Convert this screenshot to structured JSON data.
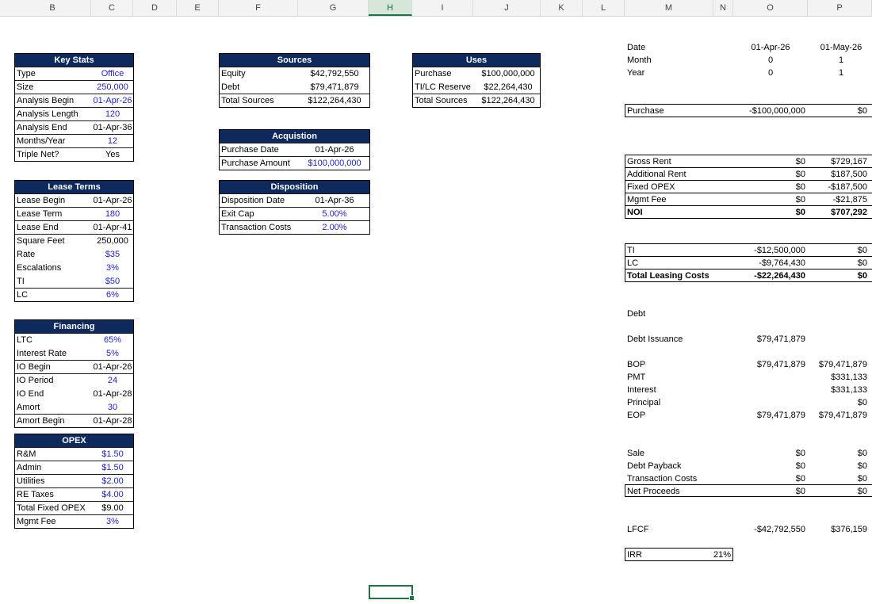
{
  "columns": [
    "B",
    "C",
    "D",
    "E",
    "F",
    "G",
    "H",
    "I",
    "J",
    "K",
    "L",
    "M",
    "N",
    "O",
    "P"
  ],
  "selected_column": "H",
  "key_stats": {
    "title": "Key Stats",
    "rows": [
      {
        "label": "Type",
        "value": "Office",
        "blue": true
      },
      {
        "label": "Size",
        "value": "250,000",
        "blue": true
      },
      {
        "label": "Analysis Begin",
        "value": "01-Apr-26",
        "blue": true
      },
      {
        "label": "Analysis Length",
        "value": "120",
        "blue": true
      },
      {
        "label": "Analysis End",
        "value": "01-Apr-36",
        "blue": false
      },
      {
        "label": "Months/Year",
        "value": "12",
        "blue": true
      },
      {
        "label": "Triple Net?",
        "value": "Yes",
        "blue": false
      }
    ]
  },
  "lease_terms": {
    "title": "Lease Terms",
    "rows": [
      {
        "label": "Lease Begin",
        "value": "01-Apr-26",
        "blue": false
      },
      {
        "label": "Lease Term",
        "value": "180",
        "blue": true
      },
      {
        "label": "Lease End",
        "value": "01-Apr-41",
        "blue": false
      },
      {
        "label": "Square Feet",
        "value": "250,000",
        "blue": false
      },
      {
        "label": "Rate",
        "value": "$35",
        "blue": true
      },
      {
        "label": "Escalations",
        "value": "3%",
        "blue": true
      },
      {
        "label": "TI",
        "value": "$50",
        "blue": true
      },
      {
        "label": "LC",
        "value": "6%",
        "blue": true
      }
    ]
  },
  "financing": {
    "title": "Financing",
    "rows": [
      {
        "label": "LTC",
        "value": "65%",
        "blue": true
      },
      {
        "label": "Interest Rate",
        "value": "5%",
        "blue": true
      },
      {
        "label": "IO Begin",
        "value": "01-Apr-26",
        "blue": false
      },
      {
        "label": "IO Period",
        "value": "24",
        "blue": true
      },
      {
        "label": "IO End",
        "value": "01-Apr-28",
        "blue": false
      },
      {
        "label": "Amort",
        "value": "30",
        "blue": true
      },
      {
        "label": "Amort Begin",
        "value": "01-Apr-28",
        "blue": false
      }
    ]
  },
  "opex": {
    "title": "OPEX",
    "rows": [
      {
        "label": "R&M",
        "value": "$1.50",
        "blue": true
      },
      {
        "label": "Admin",
        "value": "$1.50",
        "blue": true
      },
      {
        "label": "Utilities",
        "value": "$2.00",
        "blue": true
      },
      {
        "label": "RE Taxes",
        "value": "$4.00",
        "blue": true
      },
      {
        "label": "Total Fixed OPEX",
        "value": "$9.00",
        "blue": false
      },
      {
        "label": "Mgmt Fee",
        "value": "3%",
        "blue": true
      }
    ]
  },
  "sources": {
    "title": "Sources",
    "rows": [
      {
        "label": "Equity",
        "value": "$42,792,550"
      },
      {
        "label": "Debt",
        "value": "$79,471,879"
      },
      {
        "label": "Total Sources",
        "value": "$122,264,430"
      }
    ]
  },
  "uses": {
    "title": "Uses",
    "rows": [
      {
        "label": "Purchase",
        "value": "$100,000,000"
      },
      {
        "label": "TI/LC Reserve",
        "value": "$22,264,430"
      },
      {
        "label": "Total Sources",
        "value": "$122,264,430"
      }
    ]
  },
  "acquisition": {
    "title": "Acquistion",
    "rows": [
      {
        "label": "Purchase Date",
        "value": "01-Apr-26",
        "blue": false
      },
      {
        "label": "Purchase Amount",
        "value": "$100,000,000",
        "blue": true
      }
    ]
  },
  "disposition": {
    "title": "Disposition",
    "rows": [
      {
        "label": "Disposition Date",
        "value": "01-Apr-36",
        "blue": false
      },
      {
        "label": "Exit Cap",
        "value": "5.00%",
        "blue": true
      },
      {
        "label": "Transaction Costs",
        "value": "2.00%",
        "blue": true
      }
    ]
  },
  "timeline": {
    "labels": [
      "Date",
      "Month",
      "Year"
    ],
    "col_o": [
      "01-Apr-26",
      "0",
      "0"
    ],
    "col_p": [
      "01-May-26",
      "1",
      "1"
    ]
  },
  "purchase_row": {
    "label": "Purchase",
    "o": "-$100,000,000",
    "p": "$0"
  },
  "noi": {
    "rows": [
      {
        "label": "Gross Rent",
        "o": "$0",
        "p": "$729,167"
      },
      {
        "label": "Additional Rent",
        "o": "$0",
        "p": "$187,500"
      },
      {
        "label": "Fixed OPEX",
        "o": "$0",
        "p": "-$187,500"
      },
      {
        "label": "Mgmt Fee",
        "o": "$0",
        "p": "-$21,875"
      },
      {
        "label": "NOI",
        "o": "$0",
        "p": "$707,292"
      }
    ]
  },
  "leasing": {
    "rows": [
      {
        "label": "TI",
        "o": "-$12,500,000",
        "p": "$0"
      },
      {
        "label": "LC",
        "o": "-$9,764,430",
        "p": "$0"
      },
      {
        "label": "Total Leasing Costs",
        "o": "-$22,264,430",
        "p": "$0"
      }
    ]
  },
  "debt": {
    "heading": "Debt",
    "issuance_label": "Debt Issuance",
    "issuance_o": "$79,471,879",
    "rows": [
      {
        "label": "BOP",
        "o": "$79,471,879",
        "p": "$79,471,879"
      },
      {
        "label": "PMT",
        "o": "",
        "p": "$331,133"
      },
      {
        "label": "Interest",
        "o": "",
        "p": "$331,133"
      },
      {
        "label": "Principal",
        "o": "",
        "p": "$0"
      },
      {
        "label": "EOP",
        "o": "$79,471,879",
        "p": "$79,471,879"
      }
    ]
  },
  "sale": {
    "rows": [
      {
        "label": "Sale",
        "o": "$0",
        "p": "$0"
      },
      {
        "label": "Debt Payback",
        "o": "$0",
        "p": "$0"
      },
      {
        "label": "Transaction Costs",
        "o": "$0",
        "p": "$0"
      },
      {
        "label": "Net Proceeds",
        "o": "$0",
        "p": "$0"
      }
    ]
  },
  "lfcf": {
    "label": "LFCF",
    "o": "-$42,792,550",
    "p": "$376,159"
  },
  "irr": {
    "label": "IRR",
    "value": "21%"
  }
}
